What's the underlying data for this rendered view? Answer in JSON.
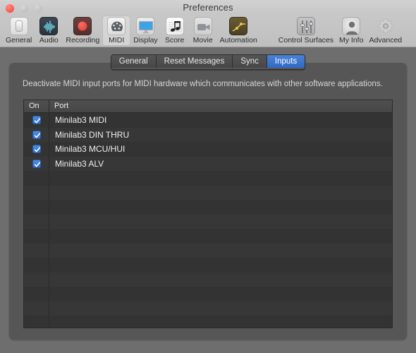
{
  "window": {
    "title": "Preferences",
    "traffic_lights": [
      "close-button",
      "minimize-button",
      "maximize-button"
    ]
  },
  "toolbar": {
    "items": [
      {
        "label": "General",
        "icon": "general-icon",
        "selected": false
      },
      {
        "label": "Audio",
        "icon": "audio-waveform-icon",
        "selected": false
      },
      {
        "label": "Recording",
        "icon": "record-icon",
        "selected": false
      },
      {
        "label": "MIDI",
        "icon": "midi-din-icon",
        "selected": true
      },
      {
        "label": "Display",
        "icon": "display-monitor-icon",
        "selected": false
      },
      {
        "label": "Score",
        "icon": "music-note-icon",
        "selected": false
      },
      {
        "label": "Movie",
        "icon": "video-camera-icon",
        "selected": false
      },
      {
        "label": "Automation",
        "icon": "automation-curve-icon",
        "selected": false
      },
      {
        "label": "Control Surfaces",
        "icon": "faders-icon",
        "selected": false
      },
      {
        "label": "My Info",
        "icon": "user-avatar-icon",
        "selected": false
      },
      {
        "label": "Advanced",
        "icon": "gear-icon",
        "selected": false
      }
    ]
  },
  "tabs": [
    {
      "label": "General",
      "active": false
    },
    {
      "label": "Reset Messages",
      "active": false
    },
    {
      "label": "Sync",
      "active": false
    },
    {
      "label": "Inputs",
      "active": true
    }
  ],
  "panel": {
    "description": "Deactivate MIDI input ports for MIDI hardware which communicates with other software applications.",
    "table": {
      "columns": [
        "On",
        "Port"
      ],
      "rows": [
        {
          "on": true,
          "port": "Minilab3 MIDI"
        },
        {
          "on": true,
          "port": "Minilab3 DIN THRU"
        },
        {
          "on": true,
          "port": "Minilab3 MCU/HUI"
        },
        {
          "on": true,
          "port": "Minilab3 ALV"
        }
      ],
      "empty_row_count": 11
    }
  },
  "colors": {
    "accent_blue": "#2f6fd0",
    "tab_active": "#3874c8",
    "panel_bg": "#565656",
    "table_bg": "#333333",
    "table_stripe": "#373737",
    "window_bg": "#6e6e6e",
    "toolbar_bg": "#c4c4c4",
    "close_red": "#ff5f57"
  }
}
